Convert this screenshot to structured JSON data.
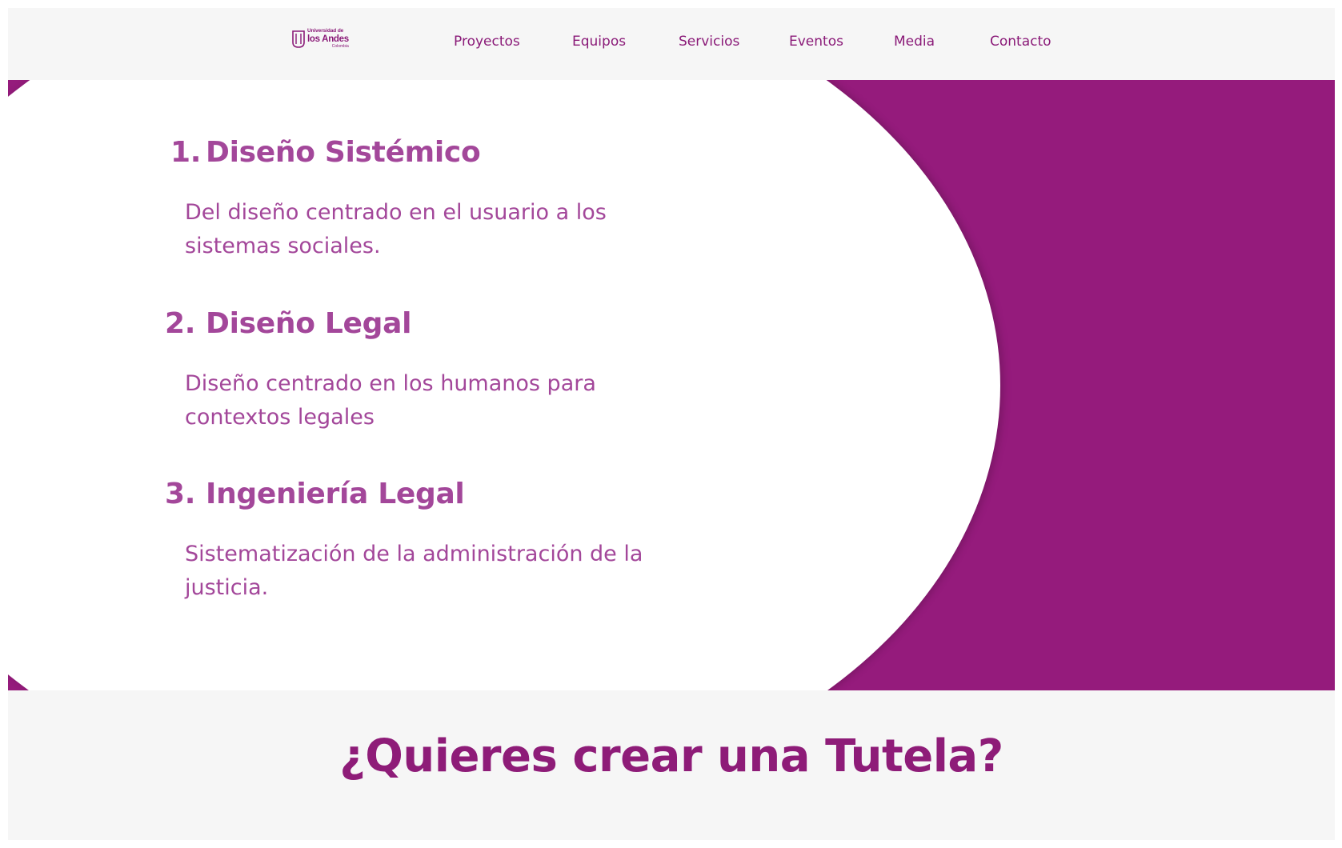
{
  "brand": {
    "logo_line1": "Universidad de",
    "logo_line2": "los Andes",
    "logo_line3": "Colombia"
  },
  "nav": {
    "items": [
      "Proyectos",
      "Equipos",
      "Servicios",
      "Eventos",
      "Media",
      "Contacto"
    ]
  },
  "services": [
    {
      "number": "1.",
      "title": "Diseño Sistémico",
      "description": "Del diseño centrado en el usuario a los sistemas sociales."
    },
    {
      "number": "2.",
      "title": "Diseño Legal",
      "description": "Diseño centrado en los humanos para contextos legales"
    },
    {
      "number": "3.",
      "title": "Ingeniería Legal",
      "description": "Sistematización de la administración de la justicia."
    }
  ],
  "cta": {
    "title": "¿Quieres crear una Tutela?"
  },
  "colors": {
    "accent": "#951b7c",
    "text_purple": "#a3479a",
    "nav_purple": "#8a1a78",
    "header_bg": "#f6f6f6"
  }
}
